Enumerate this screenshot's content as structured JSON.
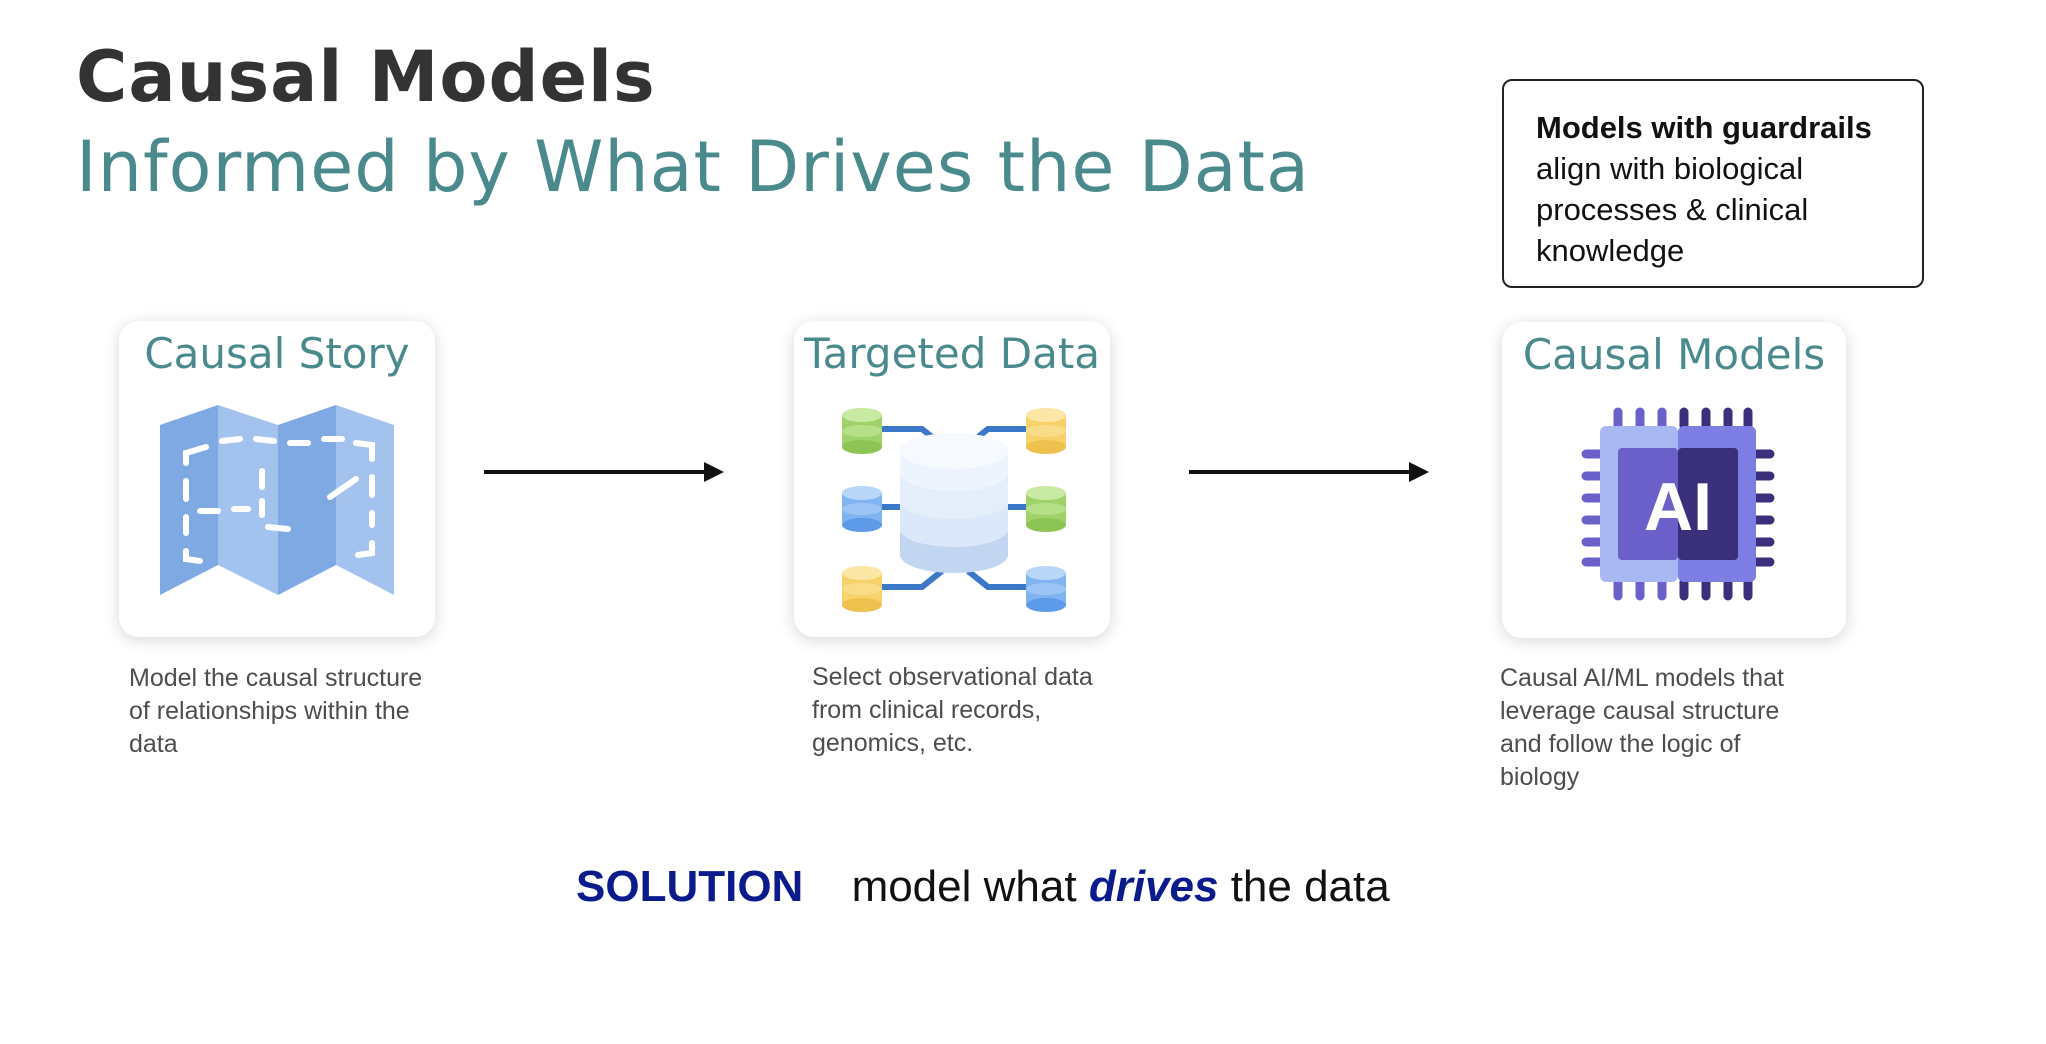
{
  "header": {
    "title": "Causal Models",
    "subtitle": "Informed by What Drives the Data"
  },
  "callout": {
    "bold": "Models with guardrails",
    "rest": "align with biological processes & clinical knowledge"
  },
  "steps": [
    {
      "title": "Causal Story",
      "icon": "map-icon",
      "description": "Model the causal structure of relationships within the data"
    },
    {
      "title": "Targeted Data",
      "icon": "database-network-icon",
      "description": "Select observational data from clinical records, genomics, etc."
    },
    {
      "title": "Causal Models",
      "icon": "ai-chip-icon",
      "icon_text": "AI",
      "description": "Causal AI/ML models that leverage causal structure and follow the logic of biology"
    }
  ],
  "solution": {
    "label": "SOLUTION",
    "text_before": "model what",
    "emphasis": "drives",
    "text_after": "the data"
  },
  "colors": {
    "title": "#333333",
    "accent_teal": "#4a8a8c",
    "solution_blue": "#0b1b8c",
    "description_text": "#4d4d4d"
  }
}
